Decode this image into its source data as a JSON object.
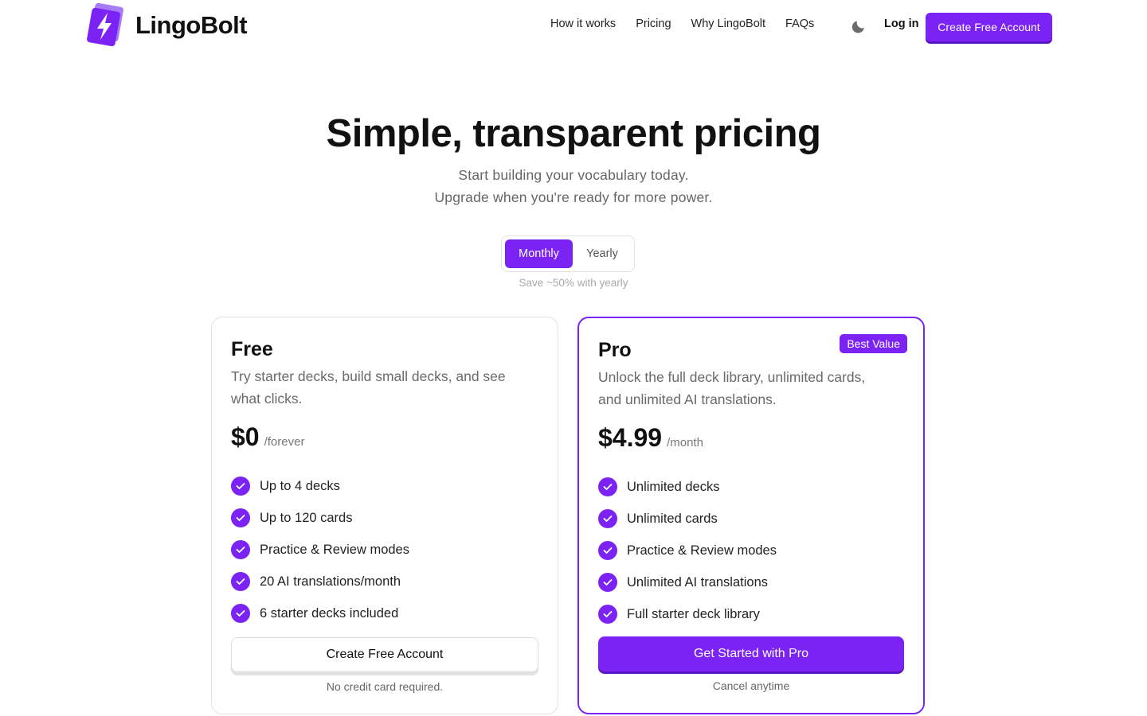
{
  "brand": {
    "name": "LingoBolt",
    "accent": "#7b22f5"
  },
  "nav": {
    "links": [
      "How it works",
      "Pricing",
      "Why LingoBolt",
      "FAQs"
    ],
    "theme_icon": "moon-icon",
    "login_label": "Log in",
    "cta_label": "Create Free Account"
  },
  "hero": {
    "title": "Simple, transparent pricing",
    "subtitle_line1": "Start building your vocabulary today.",
    "subtitle_line2": "Upgrade when you're ready for more power."
  },
  "billing": {
    "options": [
      "Monthly",
      "Yearly"
    ],
    "selected": "Monthly",
    "note": "Save ~50% with yearly"
  },
  "plans": [
    {
      "name": "Free",
      "description": "Try starter decks, build small decks, and see what clicks.",
      "price": "$0",
      "period": "/forever",
      "features": [
        "Up to 4 decks",
        "Up to 120 cards",
        "Practice & Review modes",
        "20 AI translations/month",
        "6 starter decks included"
      ],
      "button_label": "Create Free Account",
      "note": "No credit card required."
    },
    {
      "name": "Pro",
      "badge": "Best Value",
      "description": "Unlock the full deck library, unlimited cards, and unlimited AI translations.",
      "price": "$4.99",
      "period": "/month",
      "features": [
        "Unlimited decks",
        "Unlimited cards",
        "Practice & Review modes",
        "Unlimited AI translations",
        "Full starter deck library"
      ],
      "button_label": "Get Started with Pro",
      "note": "Cancel anytime"
    }
  ]
}
